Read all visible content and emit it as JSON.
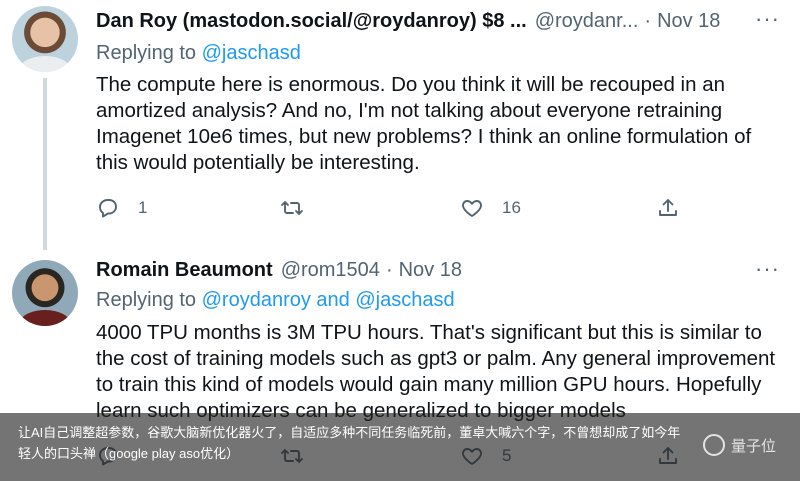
{
  "tweets": [
    {
      "author_name": "Dan Roy (mastodon.social/@roydanroy) $8 ...",
      "handle": "@roydanr...",
      "separator": "·",
      "date": "Nov 18",
      "more_icon": "more-horizontal-icon",
      "replying_label": "Replying to ",
      "replying_mentions": "@jaschasd",
      "body_lines": [
        "The compute here is enormous. Do you think it will be recouped in an",
        "amortized analysis? And no, I'm not talking about everyone retraining",
        "Imagenet 10e6 times, but new problems? I think an online formulation of",
        "this would potentially be interesting."
      ],
      "replies": "1",
      "retweets": "",
      "likes": "16"
    },
    {
      "author_name": "Romain Beaumont",
      "handle": "@rom1504",
      "separator": "·",
      "date": "Nov 18",
      "more_icon": "more-horizontal-icon",
      "replying_label": "Replying to ",
      "replying_mentions": "@roydanroy and @jaschasd",
      "body_lines": [
        "4000 TPU months is 3M TPU hours. That's significant but this is similar to",
        "the cost of training models such as gpt3 or palm. Any general improvement",
        "to train this kind of models would gain many million GPU hours. Hopefully",
        "learn such optimizers can be generalized to bigger models"
      ],
      "replies": "",
      "retweets": "",
      "likes": "5"
    }
  ],
  "caption": {
    "line1": "让AI自己调整超参数，谷歌大脑新优化器火了，自适应多种不同任务临死前，董卓大喊六个字，不曾想却成了如今年",
    "line2": "轻人的口头禅（google play aso优化）"
  },
  "watermark": "量子位",
  "colors": {
    "text": "#0f1419",
    "secondary": "#536471",
    "link": "#1d9bf0",
    "thread_line": "#cfd9de"
  }
}
